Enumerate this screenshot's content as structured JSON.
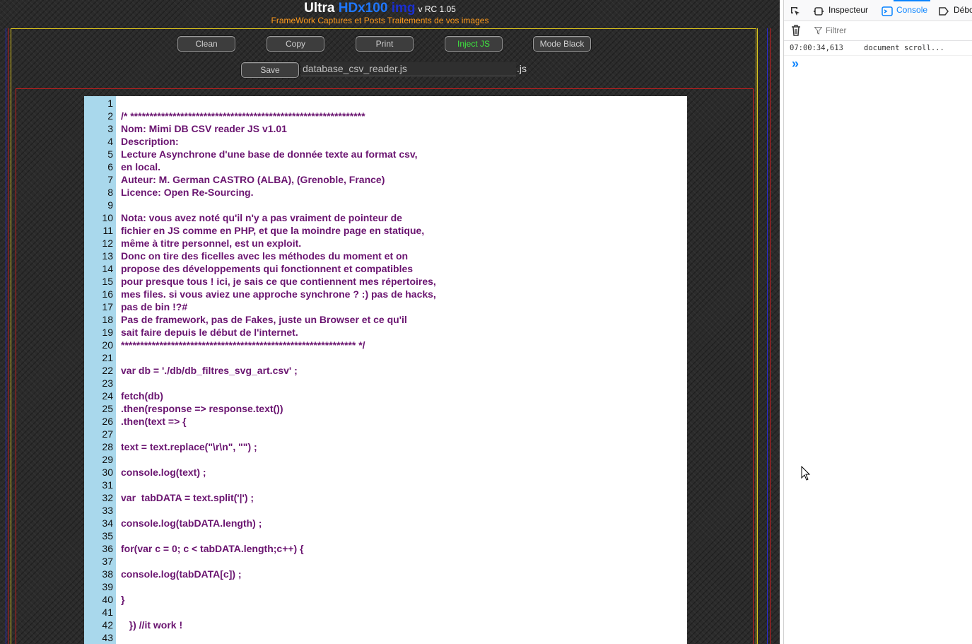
{
  "app": {
    "title_part1": "Ultra ",
    "title_part2": "HDx100 ",
    "title_part3": "img",
    "version": "v RC 1.05",
    "subtitle": "FrameWork Captures et Posts Traitements de vos images"
  },
  "toolbar": {
    "clean_label": "Clean",
    "copy_label": "Copy",
    "print_label": "Print",
    "inject_label": "Inject JS",
    "mode_black_label": "Mode Black",
    "save_label": "Save",
    "filename_value": "database_csv_reader.js",
    "extension": ".js"
  },
  "colors": {
    "code_text": "#6a1470",
    "gutter_bg": "#a9d8ec",
    "inject_green": "#3ee63e",
    "subtitle_orange": "#ff9a1a",
    "devtools_accent": "#0a84ff"
  },
  "code_lines": [
    "",
    "/* *************************************************************",
    "Nom: Mimi DB CSV reader JS v1.01",
    "Description:",
    "Lecture Asynchrone d'une base de donnée texte au format csv,",
    "en local.",
    "Auteur: M. German CASTRO (ALBA), (Grenoble, France)",
    "Licence: Open Re-Sourcing.",
    "",
    "Nota: vous avez noté qu'il n'y a pas vraiment de pointeur de",
    "fichier en JS comme en PHP, et que la moindre page en statique,",
    "même à titre personnel, est un exploit.",
    "Donc on tire des ficelles avec les méthodes du moment et on",
    "propose des développements qui fonctionnent et compatibles",
    "pour presque tous ! ici, je sais ce que contiennent mes répertoires,",
    "mes files. si vous aviez une approche synchrone ? :) pas de hacks,",
    "pas de bin !?#",
    "Pas de framework, pas de Fakes, juste un Browser et ce qu'il",
    "sait faire depuis le début de l'internet.",
    "************************************************************* */",
    "",
    "var db = './db/db_filtres_svg_art.csv' ;",
    "",
    "fetch(db)",
    ".then(response => response.text())",
    ".then(text => {",
    "",
    "text = text.replace(\"\\r\\n\", \"\") ;",
    "",
    "console.log(text) ;",
    "",
    "var  tabDATA = text.split('|') ;",
    "",
    "console.log(tabDATA.length) ;",
    "",
    "for(var c = 0; c < tabDATA.length;c++) {",
    "",
    "console.log(tabDATA[c]) ;",
    "",
    "}",
    "",
    "   }) //it work !",
    ""
  ],
  "devtools": {
    "tabs": [
      "Inspecteur",
      "Console",
      "Débo"
    ],
    "active_tab": "Console",
    "filter_placeholder": "Filtrer",
    "log_time": "07:00:34,613",
    "log_message": "document scroll...",
    "prompt_symbol": "»"
  }
}
